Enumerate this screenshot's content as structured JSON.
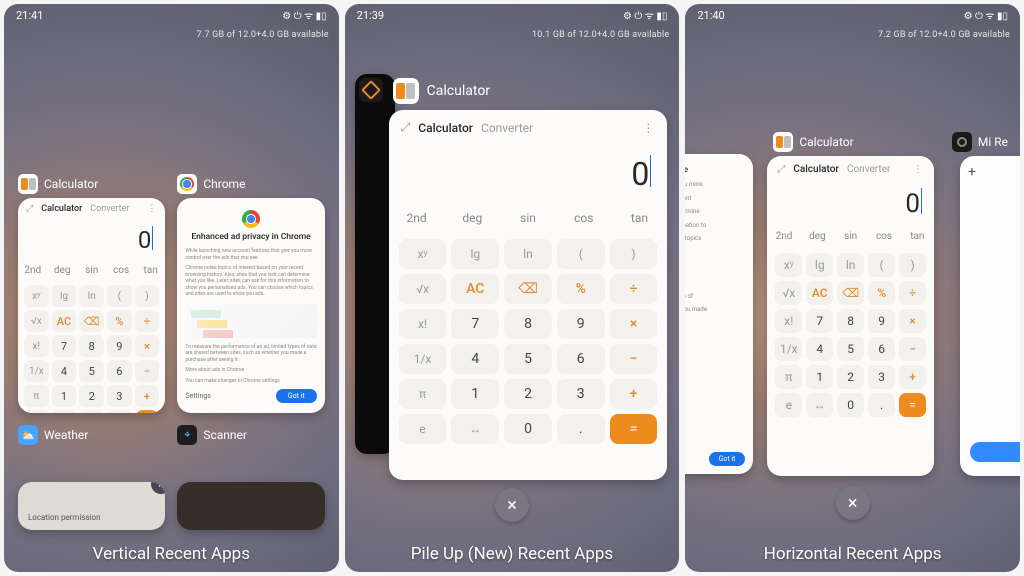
{
  "status_icons": "⚙ ⏻ ᯤ ▮▯",
  "captions": {
    "p1": "Vertical Recent Apps",
    "p2": "Pile Up (New) Recent Apps",
    "p3": "Horizontal Recent Apps"
  },
  "panels": {
    "p1": {
      "time": "21:41",
      "mem": "7.7 GB of 12.0+4.0 GB available"
    },
    "p2": {
      "time": "21:39",
      "mem": "10.1 GB of 12.0+4.0 GB available"
    },
    "p3": {
      "time": "21:40",
      "mem": "7.2 GB of 12.0+4.0 GB available"
    }
  },
  "apps": {
    "calculator": "Calculator",
    "chrome": "Chrome",
    "weather": "Weather",
    "scanner": "Scanner",
    "miremote": "Mi Re"
  },
  "calc": {
    "tab_calc": "Calculator",
    "tab_conv": "Converter",
    "display": "0",
    "scirow": [
      "2nd",
      "deg",
      "sin",
      "cos",
      "tan"
    ],
    "rows": [
      [
        "xʸ",
        "lg",
        "ln",
        "(",
        ")"
      ],
      [
        "√x",
        "AC",
        "⌫",
        "%",
        "÷"
      ],
      [
        "x!",
        "7",
        "8",
        "9",
        "×"
      ],
      [
        "1/x",
        "4",
        "5",
        "6",
        "−"
      ],
      [
        "π",
        "1",
        "2",
        "3",
        "+"
      ],
      [
        "e",
        "↔",
        "0",
        ".",
        "="
      ]
    ]
  },
  "chrome": {
    "title": "Enhanced ad privacy in Chrome",
    "p1": "While launching new account features that give you more control over the ads that you see",
    "p2": "Chrome notes topics of interest based on your recent browsing history. Also, sites that you visit can determine what you like. Later, sites can ask for this information to show you personalised ads. You can choose which topics and sites are used to show you ads.",
    "p3": "To measure the performance of an ad, limited types of data are shared between sites, such as whether you made a purchase after seeing it.",
    "more": "More about ads in Chrome",
    "settings": "You can make changes in Chrome settings",
    "link": "Settings",
    "btn": "Got it"
  },
  "chrome_peek": {
    "h": "n Chrome",
    "l1": "that give you more",
    "l2": "on your recent",
    "l3": "sit can determine",
    "l4": "r this information to",
    "l5": "ocse which topics",
    "l6": "imited types of",
    "l7": "s whether you made"
  },
  "loc": "Location permission",
  "close": "×",
  "plus": "+"
}
